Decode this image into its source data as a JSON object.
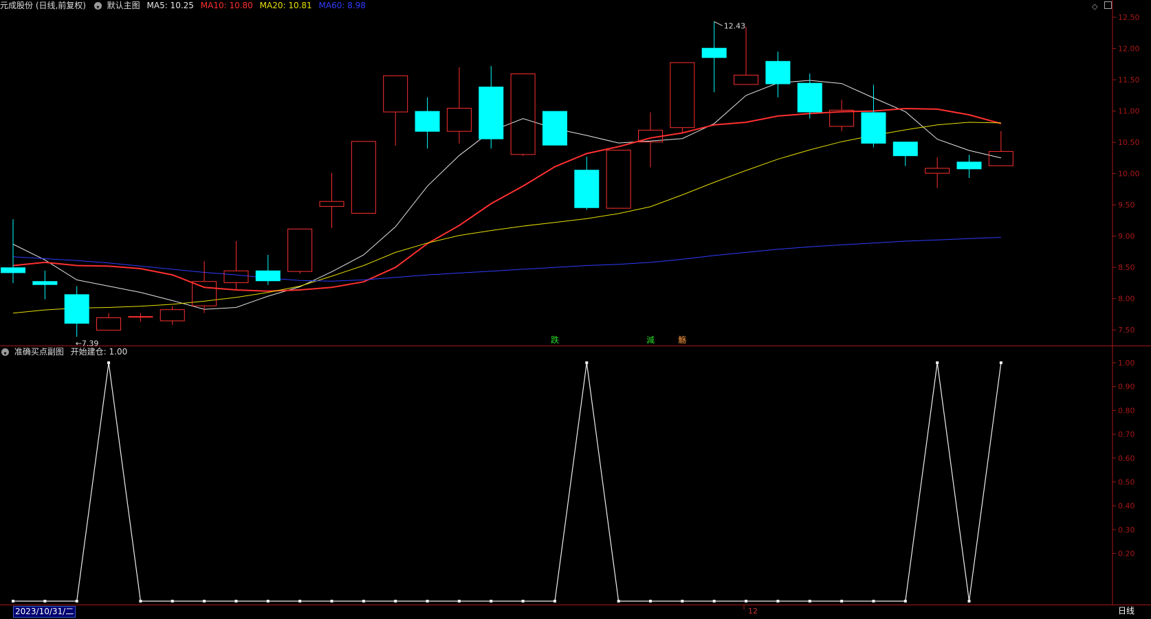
{
  "main_panel": {
    "title": "元成股份 (日线,前复权)",
    "indicator_name": "默认主图",
    "ma_labels": [
      {
        "text": "MA5: 10.25",
        "color": "#e6e6e6"
      },
      {
        "text": "MA10: 10.80",
        "color": "#ff3030"
      },
      {
        "text": "MA20: 10.81",
        "color": "#e8e000"
      },
      {
        "text": "MA60: 8.98",
        "color": "#2f3cff"
      }
    ],
    "high_marker": "12.43",
    "low_marker": "7.39",
    "signals": [
      {
        "text": "跌",
        "color": "#27d827",
        "at": 17
      },
      {
        "text": "減",
        "color": "#27d827",
        "at": 20
      },
      {
        "text": "觞",
        "color": "#ff9a40",
        "at": 21
      }
    ]
  },
  "sub_panel": {
    "indicator_name": "准确买点副图",
    "value_label": "开始建仓: 1.00"
  },
  "toolbar": {
    "diamond_icon": "◇",
    "square_icon": "▢"
  },
  "bottom": {
    "date": "2023/10/31/二",
    "month": "12",
    "period": "日线"
  },
  "colors": {
    "up": "#ff3030",
    "down": "#00ffff",
    "axis": "#a81818",
    "bg": "#000000"
  },
  "chart_data": [
    {
      "type": "candlestick",
      "title": "默认主图",
      "ylim": [
        7.25,
        12.6
      ],
      "y_ticks": [
        "12.50",
        "12.00",
        "11.50",
        "11.00",
        "10.50",
        "10.00",
        "9.50",
        "9.00",
        "8.50",
        "8.00",
        "7.50"
      ],
      "candles": [
        {
          "o": 8.5,
          "h": 9.27,
          "l": 8.25,
          "c": 8.41
        },
        {
          "o": 8.28,
          "h": 8.45,
          "l": 7.99,
          "c": 8.22
        },
        {
          "o": 8.07,
          "h": 8.2,
          "l": 7.39,
          "c": 7.6
        },
        {
          "o": 7.49,
          "h": 7.77,
          "l": 7.49,
          "c": 7.7
        },
        {
          "o": 7.72,
          "h": 7.77,
          "l": 7.63,
          "c": 7.72
        },
        {
          "o": 7.64,
          "h": 7.88,
          "l": 7.58,
          "c": 7.83
        },
        {
          "o": 7.88,
          "h": 8.6,
          "l": 7.77,
          "c": 8.28
        },
        {
          "o": 8.25,
          "h": 8.92,
          "l": 8.14,
          "c": 8.45
        },
        {
          "o": 8.45,
          "h": 8.7,
          "l": 8.22,
          "c": 8.28
        },
        {
          "o": 8.43,
          "h": 9.12,
          "l": 8.4,
          "c": 9.12
        },
        {
          "o": 9.47,
          "h": 10.01,
          "l": 9.13,
          "c": 9.56
        },
        {
          "o": 9.36,
          "h": 10.52,
          "l": 9.36,
          "c": 10.52
        },
        {
          "o": 10.98,
          "h": 11.57,
          "l": 10.45,
          "c": 11.57
        },
        {
          "o": 11.0,
          "h": 11.22,
          "l": 10.4,
          "c": 10.67
        },
        {
          "o": 10.67,
          "h": 11.7,
          "l": 10.48,
          "c": 11.05
        },
        {
          "o": 11.39,
          "h": 11.72,
          "l": 10.4,
          "c": 10.55
        },
        {
          "o": 10.3,
          "h": 11.6,
          "l": 10.28,
          "c": 11.6
        },
        {
          "o": 11.0,
          "h": 11.0,
          "l": 10.45,
          "c": 10.45
        },
        {
          "o": 10.06,
          "h": 10.27,
          "l": 9.42,
          "c": 9.45
        },
        {
          "o": 9.44,
          "h": 10.38,
          "l": 9.44,
          "c": 10.38
        },
        {
          "o": 10.5,
          "h": 10.98,
          "l": 10.1,
          "c": 10.7
        },
        {
          "o": 10.73,
          "h": 11.78,
          "l": 10.65,
          "c": 11.78
        },
        {
          "o": 12.01,
          "h": 12.43,
          "l": 11.3,
          "c": 11.85
        },
        {
          "o": 11.42,
          "h": 12.35,
          "l": 11.42,
          "c": 11.58
        },
        {
          "o": 11.8,
          "h": 11.95,
          "l": 11.22,
          "c": 11.43
        },
        {
          "o": 11.45,
          "h": 11.6,
          "l": 10.88,
          "c": 10.98
        },
        {
          "o": 10.75,
          "h": 11.18,
          "l": 10.68,
          "c": 11.02
        },
        {
          "o": 10.98,
          "h": 11.42,
          "l": 10.42,
          "c": 10.48
        },
        {
          "o": 10.51,
          "h": 10.51,
          "l": 10.12,
          "c": 10.28
        },
        {
          "o": 10.0,
          "h": 10.26,
          "l": 9.77,
          "c": 10.09
        },
        {
          "o": 10.19,
          "h": 10.3,
          "l": 9.93,
          "c": 10.07
        },
        {
          "o": 10.12,
          "h": 10.68,
          "l": 10.12,
          "c": 10.36
        }
      ],
      "series": [
        {
          "name": "MA5",
          "values": [
            8.87,
            8.62,
            8.3,
            8.2,
            8.1,
            7.97,
            7.83,
            7.86,
            8.04,
            8.19,
            8.43,
            8.7,
            9.15,
            9.8,
            10.29,
            10.68,
            10.88,
            10.72,
            10.61,
            10.49,
            10.52,
            10.56,
            10.8,
            11.25,
            11.45,
            11.49,
            11.44,
            11.21,
            10.99,
            10.55,
            10.37,
            10.25
          ]
        },
        {
          "name": "MA10",
          "values": [
            8.53,
            8.58,
            8.53,
            8.52,
            8.48,
            8.38,
            8.18,
            8.14,
            8.12,
            8.14,
            8.18,
            8.27,
            8.5,
            8.88,
            9.17,
            9.52,
            9.8,
            10.11,
            10.32,
            10.43,
            10.57,
            10.65,
            10.78,
            10.82,
            10.92,
            10.96,
            10.99,
            11.0,
            11.04,
            11.03,
            10.94,
            10.8
          ]
        },
        {
          "name": "MA20",
          "values": [
            7.77,
            7.82,
            7.85,
            7.86,
            7.88,
            7.91,
            7.96,
            8.02,
            8.1,
            8.2,
            8.36,
            8.53,
            8.74,
            8.89,
            9.01,
            9.09,
            9.16,
            9.22,
            9.28,
            9.36,
            9.47,
            9.66,
            9.86,
            10.05,
            10.23,
            10.38,
            10.51,
            10.61,
            10.7,
            10.78,
            10.82,
            10.81
          ]
        },
        {
          "name": "MA60",
          "values": [
            8.67,
            8.64,
            8.61,
            8.57,
            8.52,
            8.47,
            8.42,
            8.38,
            8.33,
            8.29,
            8.28,
            8.3,
            8.34,
            8.38,
            8.41,
            8.44,
            8.47,
            8.5,
            8.53,
            8.55,
            8.58,
            8.63,
            8.69,
            8.74,
            8.79,
            8.83,
            8.86,
            8.89,
            8.92,
            8.94,
            8.96,
            8.98
          ]
        }
      ]
    },
    {
      "type": "line",
      "title": "准确买点副图",
      "ylim": [
        0,
        1.0
      ],
      "y_ticks": [
        "1.00",
        "0.90",
        "0.80",
        "0.70",
        "0.60",
        "0.50",
        "0.40",
        "0.30",
        "0.20"
      ],
      "series": [
        {
          "name": "开始建仓",
          "values": [
            0,
            0,
            0,
            1,
            0,
            0,
            0,
            0,
            0,
            0,
            0,
            0,
            0,
            0,
            0,
            0,
            0,
            0,
            1,
            0,
            0,
            0,
            0,
            0,
            0,
            0,
            0,
            0,
            0,
            1,
            0,
            1
          ]
        }
      ]
    }
  ]
}
